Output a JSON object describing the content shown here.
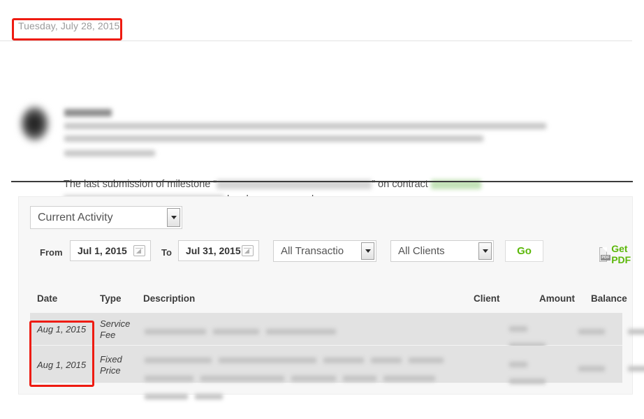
{
  "page": {
    "date_header": "Tuesday, July 28, 2015"
  },
  "notification": {
    "avatar_icon": "user-avatar-blurred",
    "body_prefix": "The last submission of milestone “",
    "body_mid": "” on contract",
    "body_suffix": "has been approved.",
    "redacted_milestone": "",
    "redacted_contract_link": "",
    "redacted_contract_name": ""
  },
  "panel": {
    "activity_select": {
      "label": "Current Activity",
      "icon": "chevron-down-icon"
    },
    "filters": {
      "from_label": "From",
      "from_value": "Jul 1, 2015",
      "to_label": "To",
      "to_value": "Jul 31, 2015",
      "calendar_icon": "calendar-icon",
      "transaction_select": "All Transactio",
      "client_select": "All Clients",
      "go_label": "Go",
      "get_pdf_label": "Get PDF",
      "pdf_icon_label": "PDF"
    },
    "table": {
      "columns": [
        "Date",
        "Type",
        "Description",
        "Client",
        "Amount",
        "Balance"
      ],
      "rows": [
        {
          "date": "Aug 1, 2015",
          "type": "Service Fee",
          "description": "",
          "client": "",
          "amount": "",
          "balance": ""
        },
        {
          "date": "Aug 1, 2015",
          "type": "Fixed Price",
          "description": "",
          "client": "",
          "amount": "",
          "balance": ""
        }
      ]
    }
  },
  "annotations": {
    "highlight_color": "#ee1b11",
    "boxes": [
      "date-header",
      "date-column-cells"
    ]
  },
  "colors": {
    "accent_green": "#5cb80a",
    "panel_bg": "#f7f7f7",
    "row_bg": "#e2e2e2",
    "text": "#4a4a4a"
  }
}
